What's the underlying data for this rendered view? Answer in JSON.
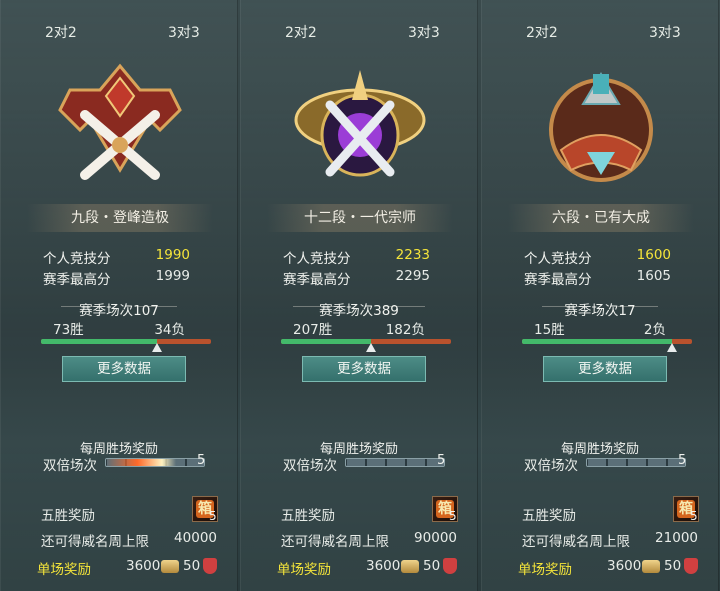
{
  "panels": [
    {
      "tabs": {
        "left": "2对2",
        "right": "3对3"
      },
      "rank": "九段・登峰造极",
      "personal_score_label": "个人竞技分",
      "personal_score": "1990",
      "season_high_label": "赛季最高分",
      "season_high": "1999",
      "season_matches": "赛季场次107",
      "wins": "73胜",
      "losses": "34负",
      "win_ratio": 0.68,
      "more_data": "更多数据",
      "weekly_reward_title": "每周胜场奖励",
      "double_label": "双倍场次",
      "double_count": "5",
      "five_win_label": "五胜奖励",
      "five_win_count": "5",
      "cap_label": "还可得威名周上限",
      "cap_value": "40000",
      "single_label": "单场奖励",
      "single_coin": "3600",
      "single_shield": "50",
      "emblem": "sword-crown-emblem-red",
      "accent": "#f4e43a"
    },
    {
      "tabs": {
        "left": "2对2",
        "right": "3对3"
      },
      "rank": "十二段・一代宗师",
      "personal_score_label": "个人竞技分",
      "personal_score": "2233",
      "season_high_label": "赛季最高分",
      "season_high": "2295",
      "season_matches": "赛季场次389",
      "wins": "207胜",
      "losses": "182负",
      "win_ratio": 0.53,
      "more_data": "更多数据",
      "weekly_reward_title": "每周胜场奖励",
      "double_label": "双倍场次",
      "double_count": "5",
      "five_win_label": "五胜奖励",
      "five_win_count": "5",
      "cap_label": "还可得威名周上限",
      "cap_value": "90000",
      "single_label": "单场奖励",
      "single_coin": "3600",
      "single_shield": "50",
      "emblem": "winged-sword-emblem-purple",
      "accent": "#f4e43a"
    },
    {
      "tabs": {
        "left": "2对2",
        "right": "3对3"
      },
      "rank": "六段・已有大成",
      "personal_score_label": "个人竞技分",
      "personal_score": "1600",
      "season_high_label": "赛季最高分",
      "season_high": "1605",
      "season_matches": "赛季场次17",
      "wins": "15胜",
      "losses": "2负",
      "win_ratio": 0.88,
      "more_data": "更多数据",
      "weekly_reward_title": "每周胜场奖励",
      "double_label": "双倍场次",
      "double_count": "5",
      "five_win_label": "五胜奖励",
      "five_win_count": "5",
      "cap_label": "还可得威名周上限",
      "cap_value": "21000",
      "single_label": "单场奖励",
      "single_coin": "3600",
      "single_shield": "50",
      "emblem": "round-shield-emblem-bronze",
      "accent": "#f4e43a"
    }
  ]
}
